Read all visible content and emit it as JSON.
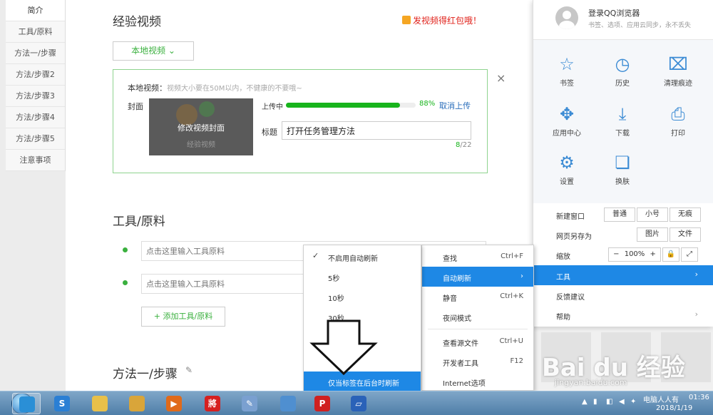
{
  "leftnav": {
    "items": [
      "简介",
      "工具/原料",
      "方法一/步骤",
      "方法/步骤2",
      "方法/步骤3",
      "方法/步骤4",
      "方法/步骤5",
      "注意事项"
    ]
  },
  "main": {
    "experience_video_title": "经验视频",
    "redpack_text": "发视频得红包哦！",
    "local_video_button": "本地视频 ⌄",
    "upload": {
      "local_video_label": "本地视频：",
      "local_video_hint": "视频大小要在50M以内，不健康的不要哦~",
      "cover_label": "封面",
      "cover_edit": "修改视频封面",
      "cover_watermark": "经验视频",
      "uploading_label": "上传中",
      "progress_percent": 88,
      "progress_text": "88%",
      "cancel_upload": "取消上传",
      "title_label": "标题",
      "title_value": "打开任务管理方法",
      "char_count_current": "8",
      "char_count_max": "/22",
      "close": "×"
    },
    "tools_title": "工具/原料",
    "tool_placeholder_1": "点击这里输入工具原料",
    "tool_placeholder_2": "点击这里输入工具原料",
    "add_tool_button": "+ 添加工具/原料",
    "steps_title": "方法一/步骤",
    "pencil": "✎"
  },
  "rpanel": {
    "login_title": "登录QQ浏览器",
    "login_sub": "书签、选项、应用云同步，永不丢失",
    "grid": [
      {
        "label": "书签",
        "icon": "☆",
        "icon_name": "star-icon"
      },
      {
        "label": "历史",
        "icon": "◷",
        "icon_name": "clock-icon"
      },
      {
        "label": "清理痕迹",
        "icon": "⌧",
        "icon_name": "broom-icon"
      },
      {
        "label": "应用中心",
        "icon": "✥",
        "icon_name": "puzzle-icon"
      },
      {
        "label": "下载",
        "icon": "⤓",
        "icon_name": "download-icon"
      },
      {
        "label": "打印",
        "icon": "⎙",
        "icon_name": "printer-icon"
      },
      {
        "label": "设置",
        "icon": "⚙",
        "icon_name": "gear-icon"
      },
      {
        "label": "换肤",
        "icon": "❏",
        "icon_name": "shirt-icon"
      }
    ],
    "new_window_label": "新建窗口",
    "new_window_options": [
      "普通",
      "小号",
      "无痕"
    ],
    "save_as_label": "网页另存为",
    "save_as_options": [
      "图片",
      "文件"
    ],
    "zoom_label": "缩放",
    "zoom_minus": "−",
    "zoom_value": "100%",
    "zoom_plus": "+",
    "lock_icon": "🔒",
    "fullscreen_icon": "⤢",
    "tools_label": "工具",
    "feedback_label": "反馈建议",
    "help_label": "帮助",
    "arrow": "›"
  },
  "ctx_menu": {
    "items": [
      {
        "label": "查找",
        "shortcut": "Ctrl+F"
      },
      {
        "label": "自动刷新",
        "shortcut": "›"
      },
      {
        "label": "静音",
        "shortcut": "Ctrl+K"
      },
      {
        "label": "夜间模式",
        "shortcut": ""
      },
      {
        "label": "查看源文件",
        "shortcut": "Ctrl+U"
      },
      {
        "label": "开发者工具",
        "shortcut": "F12"
      },
      {
        "label": "Internet选项",
        "shortcut": ""
      }
    ]
  },
  "submenu": {
    "items": [
      {
        "label": "不启用自动刷新",
        "check": "✓"
      },
      {
        "label": "5秒",
        "check": ""
      },
      {
        "label": "10秒",
        "check": ""
      },
      {
        "label": "30秒",
        "check": ""
      },
      {
        "label": "",
        "check": ""
      },
      {
        "label": "",
        "check": ""
      },
      {
        "label": "仅当标签在后台时刷新",
        "check": ""
      }
    ]
  },
  "watermark": {
    "text": "Bai du 经验",
    "url": "jingyan.baidu.com"
  },
  "taskbar": {
    "apps": [
      {
        "name": "qq-browser",
        "glyph": "",
        "color": "#2a8fd6"
      },
      {
        "name": "sogou",
        "glyph": "S",
        "color": "#2a7fd4"
      },
      {
        "name": "folder-yellow",
        "glyph": "",
        "color": "#e8c04a"
      },
      {
        "name": "explorer",
        "glyph": "",
        "color": "#d9a53a"
      },
      {
        "name": "media-player",
        "glyph": "▶",
        "color": "#e06a1a"
      },
      {
        "name": "chess",
        "glyph": "將",
        "color": "#d62020"
      },
      {
        "name": "paint",
        "glyph": "✎",
        "color": "#7aa0d0"
      },
      {
        "name": "control-panel",
        "glyph": "",
        "color": "#4f8fd0"
      },
      {
        "name": "psiphon",
        "glyph": "P",
        "color": "#d02020"
      },
      {
        "name": "app-blue",
        "glyph": "▱",
        "color": "#2a62b8"
      }
    ],
    "tray_status": "电脑人人有",
    "clock_time": "01:36",
    "clock_date": "2018/1/19"
  },
  "colors": {
    "accent_green": "#3ab03e",
    "progress_green": "#18b41c",
    "highlight_blue": "#1e88e5",
    "link_blue": "#2a6ebb",
    "red": "#e0211a"
  }
}
